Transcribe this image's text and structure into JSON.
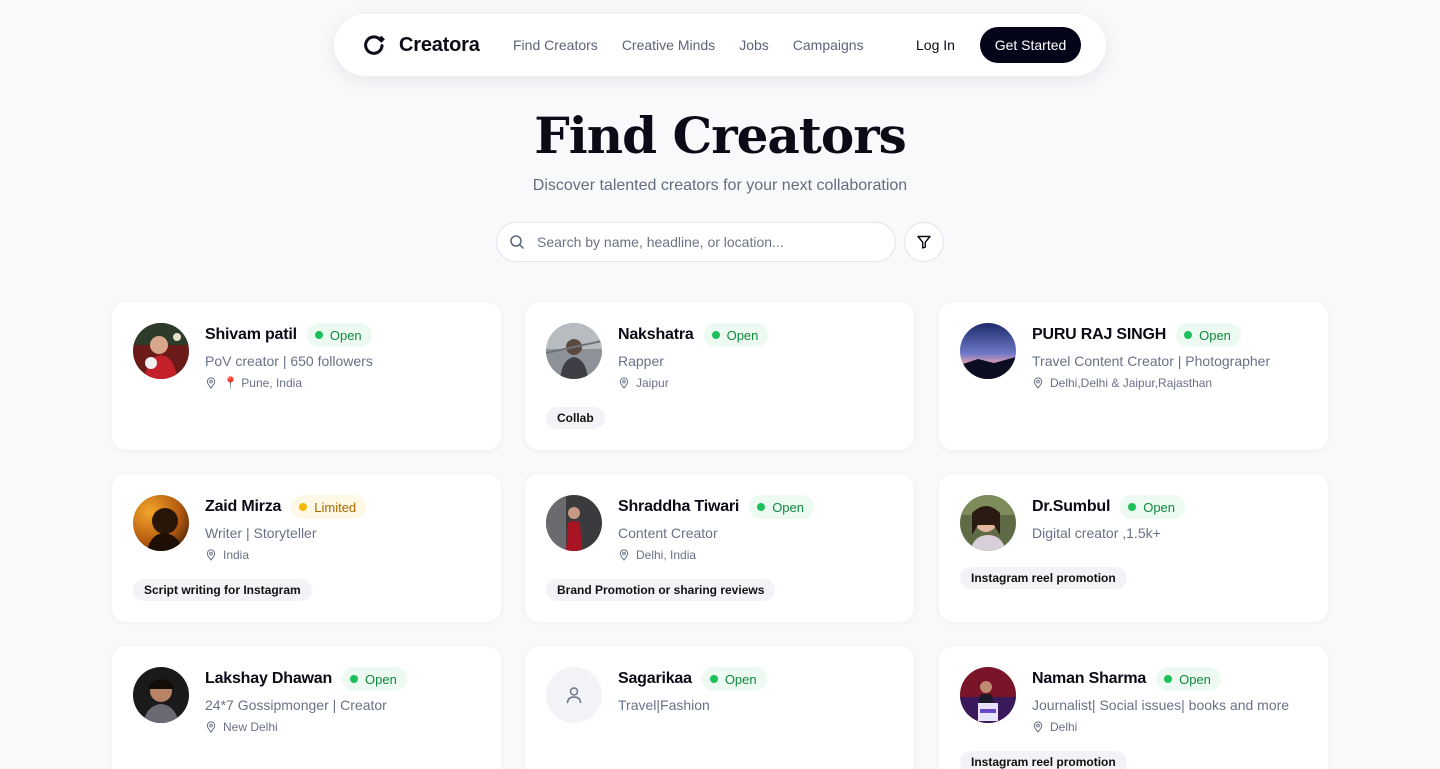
{
  "brand": {
    "name": "Creatora"
  },
  "nav": {
    "links": [
      "Find Creators",
      "Creative Minds",
      "Jobs",
      "Campaigns"
    ],
    "login": "Log In",
    "cta": "Get Started"
  },
  "hero": {
    "title": "Find Creators",
    "subtitle": "Discover talented creators for your next collaboration"
  },
  "search": {
    "placeholder": "Search by name, headline, or location..."
  },
  "creators": [
    {
      "name": "Shivam patil",
      "status": "Open",
      "headline": "PoV creator | 650 followers",
      "location": "📍 Pune, India",
      "tag": ""
    },
    {
      "name": "Nakshatra",
      "status": "Open",
      "headline": "Rapper",
      "location": "Jaipur",
      "tag": "Collab"
    },
    {
      "name": "PURU RAJ SINGH",
      "status": "Open",
      "headline": "Travel Content Creator | Photographer",
      "location": "Delhi,Delhi & Jaipur,Rajasthan",
      "tag": ""
    },
    {
      "name": "Zaid Mirza",
      "status": "Limited",
      "headline": "Writer | Storyteller",
      "location": "India",
      "tag": "Script writing for Instagram"
    },
    {
      "name": "Shraddha Tiwari",
      "status": "Open",
      "headline": "Content Creator",
      "location": "Delhi, India",
      "tag": "Brand Promotion or sharing reviews"
    },
    {
      "name": "Dr.Sumbul",
      "status": "Open",
      "headline": "Digital creator ,1.5k+",
      "location": "",
      "tag": "Instagram reel promotion"
    },
    {
      "name": "Lakshay Dhawan",
      "status": "Open",
      "headline": "24*7 Gossipmonger | Creator",
      "location": "New Delhi",
      "tag": ""
    },
    {
      "name": "Sagarikaa",
      "status": "Open",
      "headline": "Travel|Fashion",
      "location": "",
      "tag": ""
    },
    {
      "name": "Naman Sharma",
      "status": "Open",
      "headline": "Journalist| Social issues| books and more",
      "location": "Delhi",
      "tag": "Instagram reel promotion"
    }
  ],
  "colors": {
    "open": "#1cc05a",
    "limited": "#f5b800",
    "primary": "#05051a"
  }
}
